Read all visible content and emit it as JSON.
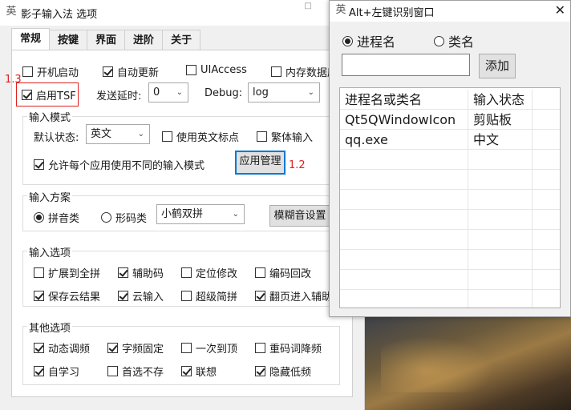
{
  "main_window": {
    "title": "影子输入法 选项",
    "app_icon_glyph": "英",
    "minimize_glyph": "□"
  },
  "tabs": [
    "常规",
    "按键",
    "界面",
    "进阶",
    "关于"
  ],
  "general": {
    "boot_start": {
      "label": "开机启动",
      "checked": false
    },
    "auto_update": {
      "label": "自动更新",
      "checked": true
    },
    "uiaccess": {
      "label": "UIAccess",
      "checked": false
    },
    "memory_data": {
      "label": "内存数据库",
      "checked": false
    },
    "enable_tsf": {
      "label": "启用TSF",
      "checked": true
    },
    "send_delay_label": "发送延时:",
    "send_delay_value": "0",
    "debug_label": "Debug:",
    "debug_value": "log"
  },
  "input_mode": {
    "title": "输入模式",
    "default_state_label": "默认状态:",
    "default_state_value": "英文",
    "english_punct": {
      "label": "使用英文标点",
      "checked": false
    },
    "traditional": {
      "label": "繁体输入",
      "checked": false
    },
    "per_app": {
      "label": "允许每个应用使用不同的输入模式",
      "checked": true
    },
    "app_manage_button": "应用管理"
  },
  "input_scheme": {
    "title": "输入方案",
    "pinyin": {
      "label": "拼音类",
      "selected": true
    },
    "shape": {
      "label": "形码类",
      "selected": false
    },
    "scheme_value": "小鹤双拼",
    "fuzzy_button": "模糊音设置"
  },
  "input_options": {
    "title": "输入选项",
    "items": [
      {
        "label": "扩展到全拼",
        "checked": false
      },
      {
        "label": "辅助码",
        "checked": true
      },
      {
        "label": "定位修改",
        "checked": false
      },
      {
        "label": "编码回改",
        "checked": false
      },
      {
        "label": "保存云结果",
        "checked": true
      },
      {
        "label": "云输入",
        "checked": true
      },
      {
        "label": "超级简拼",
        "checked": false
      },
      {
        "label": "翻页进入辅助",
        "checked": true
      }
    ]
  },
  "other_options": {
    "title": "其他选项",
    "items": [
      {
        "label": "动态调频",
        "checked": true
      },
      {
        "label": "字频固定",
        "checked": true
      },
      {
        "label": "一次到顶",
        "checked": false
      },
      {
        "label": "重码词降频",
        "checked": false
      },
      {
        "label": "自学习",
        "checked": true
      },
      {
        "label": "首选不存",
        "checked": false
      },
      {
        "label": "联想",
        "checked": true
      },
      {
        "label": "隐藏低频",
        "checked": true
      }
    ]
  },
  "annotations": {
    "note_tsf": "1.3",
    "note_app_manage": "1.2",
    "highlight_color": "#e02020"
  },
  "alt_window": {
    "title": "Alt+左键识别窗口",
    "app_icon_glyph": "英",
    "close_glyph": "✕",
    "radio_process": {
      "label": "进程名",
      "selected": true
    },
    "radio_class": {
      "label": "类名",
      "selected": false
    },
    "input_value": "",
    "add_button": "添加",
    "list_headers": [
      "进程名或类名",
      "输入状态"
    ],
    "list_rows": [
      {
        "name": "Qt5QWindowIcon",
        "state": "剪贴板"
      },
      {
        "name": "qq.exe",
        "state": "中文"
      }
    ]
  },
  "colors": {
    "focus_border": "#0078d7",
    "window_bg": "#f0f0f0"
  }
}
